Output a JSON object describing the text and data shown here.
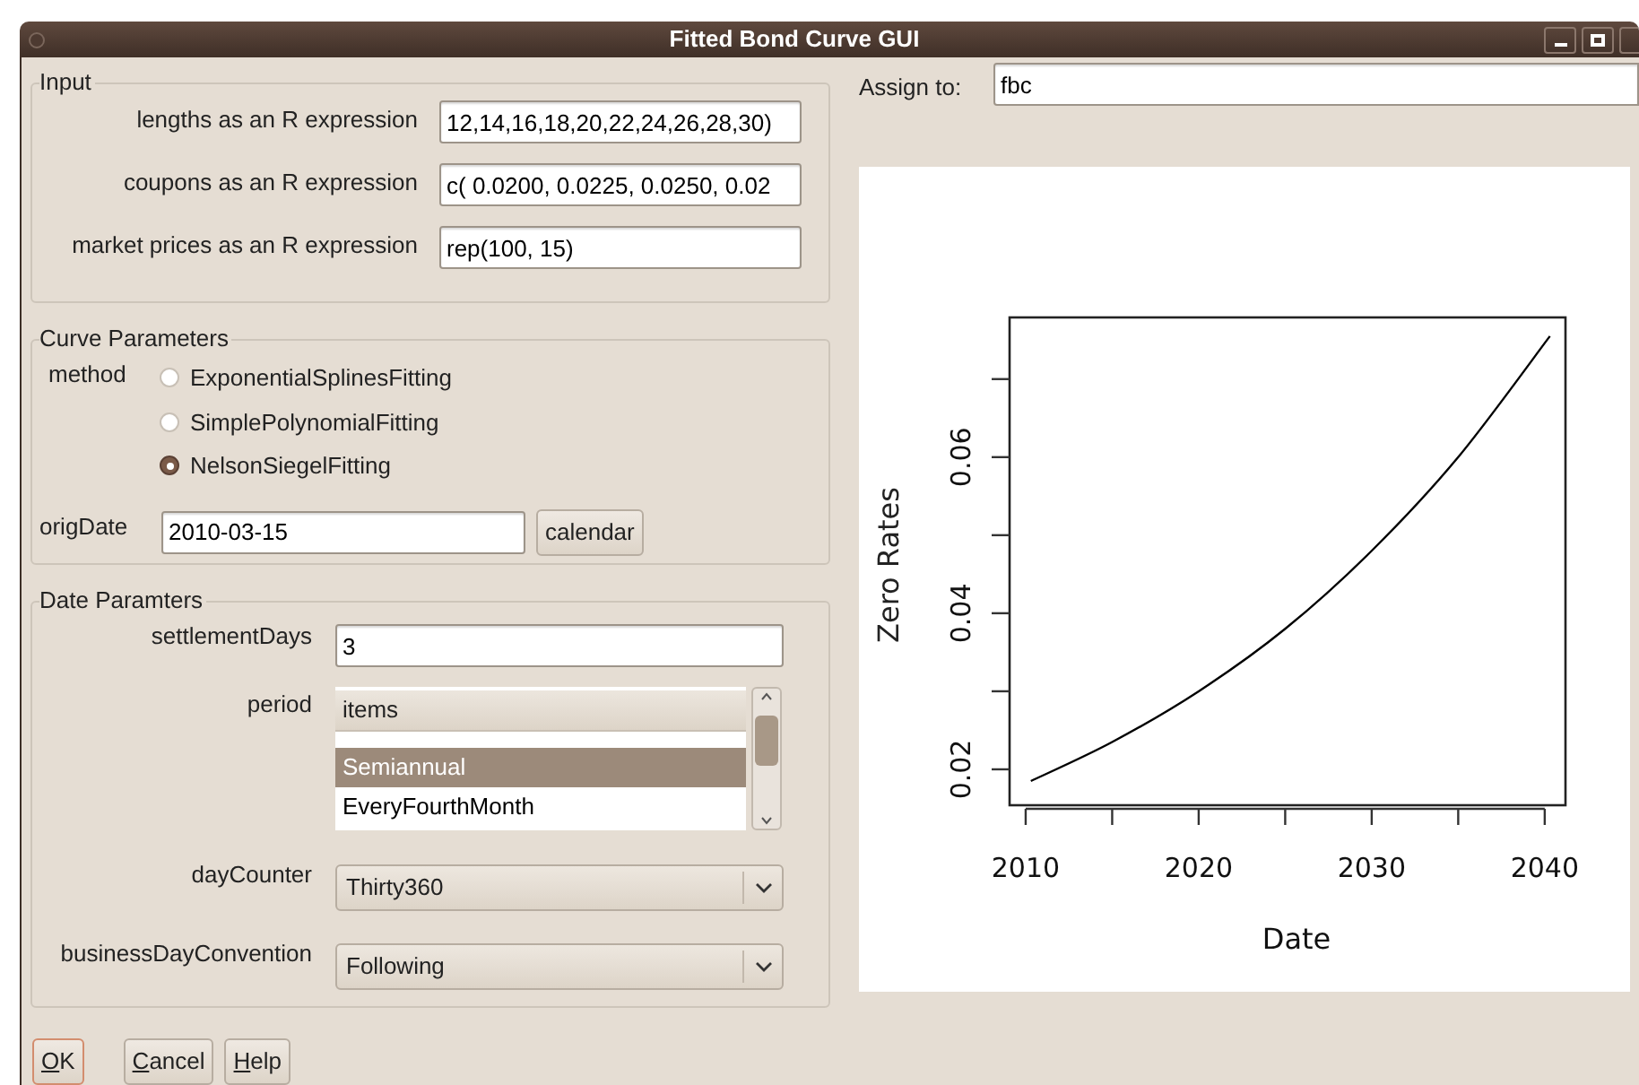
{
  "window": {
    "title": "Fitted Bond Curve GUI"
  },
  "input": {
    "title": "Input",
    "fields": [
      {
        "label": "lengths as an R expression",
        "value": "12,14,16,18,20,22,24,26,28,30)"
      },
      {
        "label": "coupons as an R expression",
        "value": "c( 0.0200, 0.0225, 0.0250, 0.02"
      },
      {
        "label": "market prices as an R expression",
        "value": "rep(100, 15)"
      }
    ]
  },
  "curve_parameters": {
    "title": "Curve Parameters",
    "method_label": "method",
    "methods": [
      {
        "label": "ExponentialSplinesFitting",
        "selected": false
      },
      {
        "label": "SimplePolynomialFitting",
        "selected": false
      },
      {
        "label": "NelsonSiegelFitting",
        "selected": true
      }
    ],
    "orig_date_label": "origDate",
    "orig_date": "2010-03-15",
    "calendar_button": "calendar"
  },
  "date_parameters": {
    "title": "Date Paramters",
    "settlement_days_label": "settlementDays",
    "settlement_days": "3",
    "period_label": "period",
    "period_header": "items",
    "period_items": [
      {
        "label": "Semiannual",
        "selected": true
      },
      {
        "label": "EveryFourthMonth",
        "selected": false
      }
    ],
    "day_counter_label": "dayCounter",
    "day_counter": "Thirty360",
    "business_day_convention_label": "businessDayConvention",
    "business_day_convention": "Following"
  },
  "buttons": [
    {
      "label": "OK",
      "default": true
    },
    {
      "label": "Cancel",
      "default": false
    },
    {
      "label": "Help",
      "default": false
    }
  ],
  "assign_label": "Assign to:",
  "assign_value": "fbc",
  "chart": {
    "chart_data": {
      "type": "line",
      "xlabel": "Date",
      "ylabel": "Zero Rates",
      "x": [
        2010.3,
        2015,
        2020,
        2025,
        2030,
        2035,
        2040.3
      ],
      "series": [
        {
          "color": "#000000",
          "values": [
            0.0185,
            0.0235,
            0.03,
            0.038,
            0.048,
            0.06,
            0.0755
          ]
        }
      ],
      "xlim": [
        2009.07,
        2041.2
      ],
      "ylim": [
        0.0154,
        0.0779
      ],
      "xticks": [
        2010,
        2020,
        2030,
        2040
      ],
      "yticks": [
        {
          "value": 0.02,
          "label": "0.02"
        },
        {
          "value": 0.04,
          "label": "0.04"
        },
        {
          "value": 0.06,
          "label": "0.06"
        }
      ]
    }
  }
}
